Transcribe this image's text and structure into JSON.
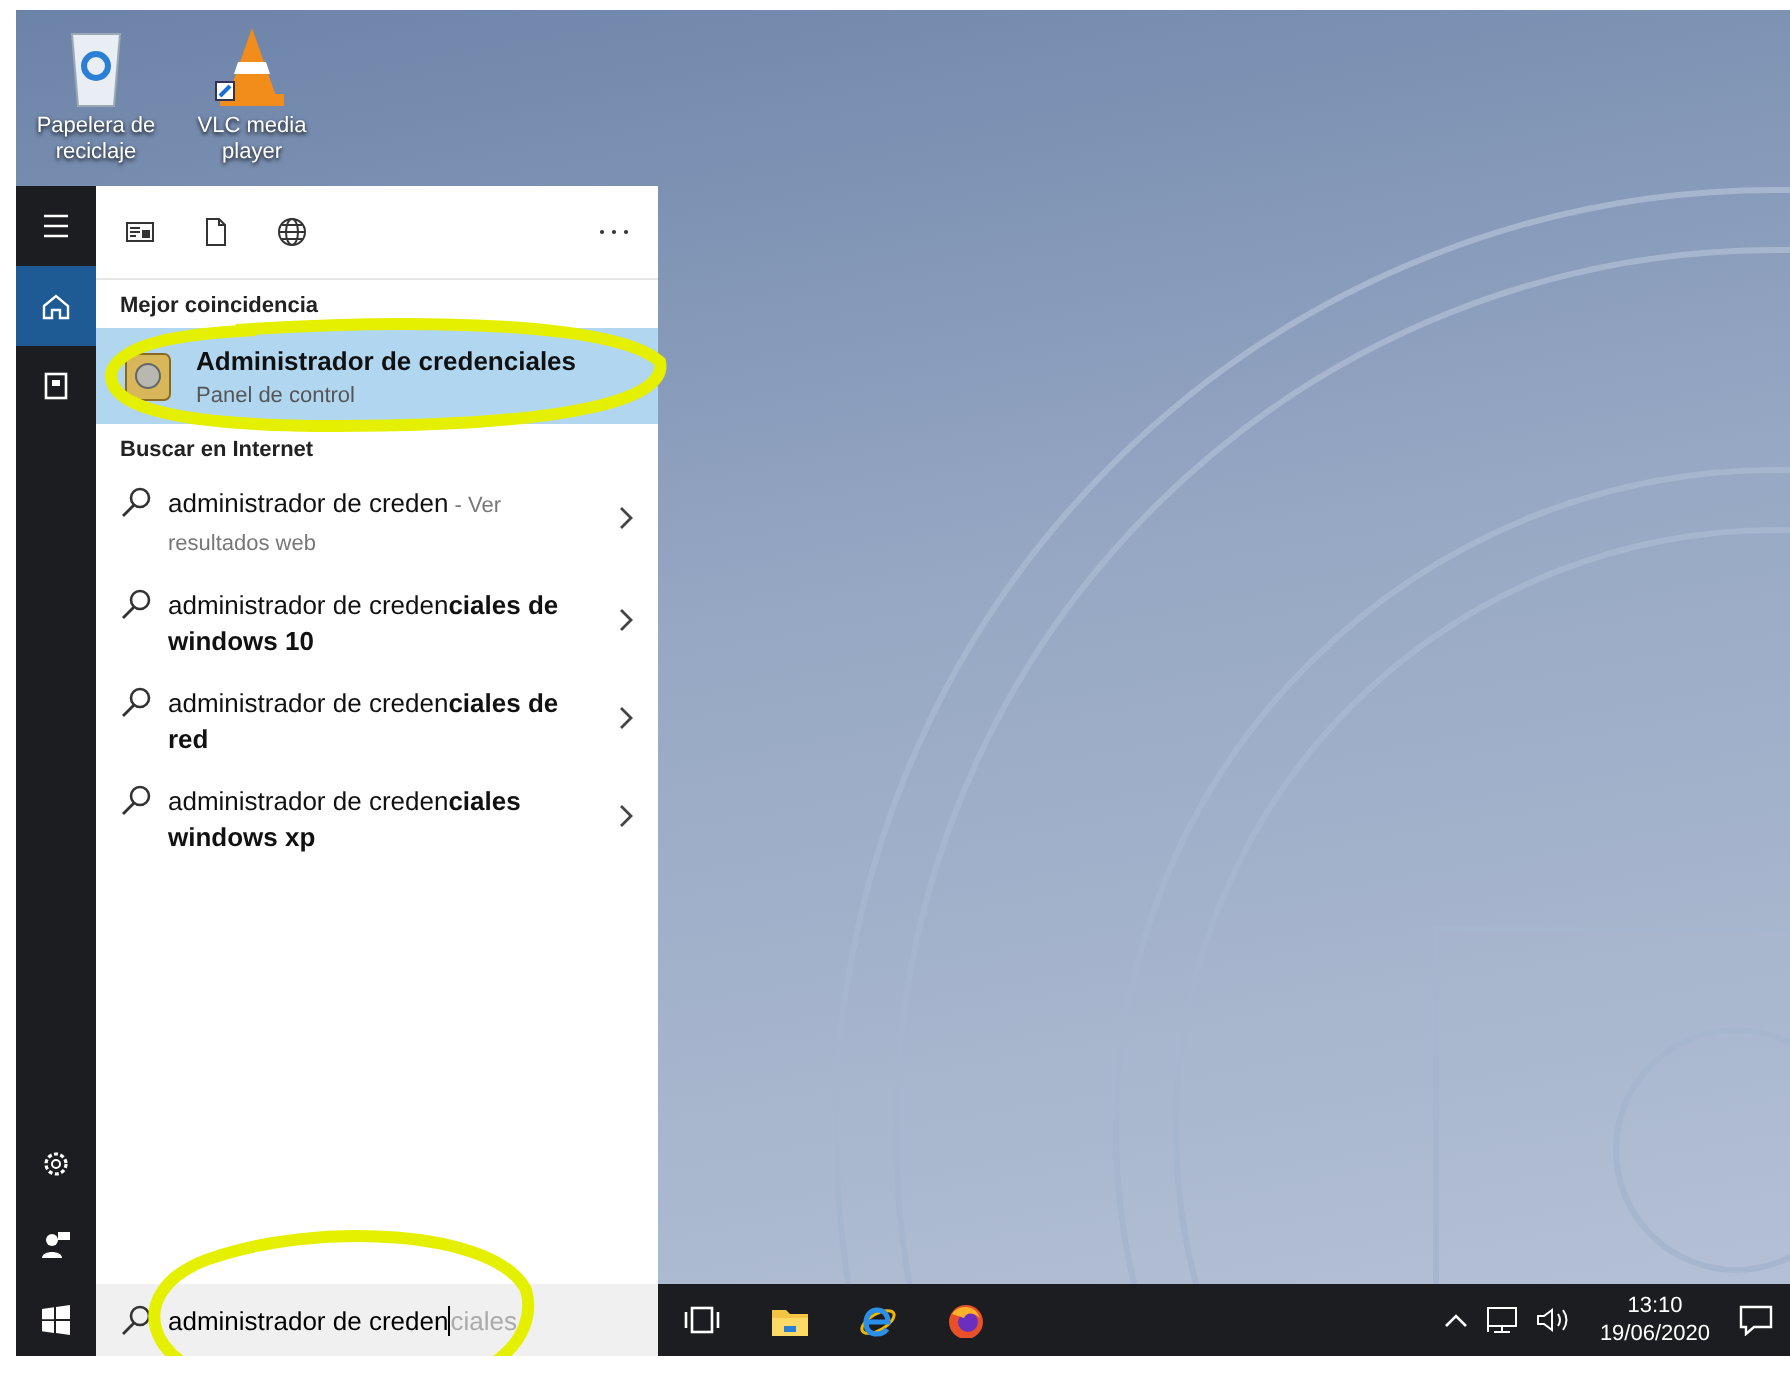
{
  "desktop_icons": [
    {
      "kind": "recycle",
      "label": "Papelera de reciclaje"
    },
    {
      "kind": "vlc",
      "label": "VLC media player"
    }
  ],
  "start_rail": {
    "top": [
      {
        "kind": "menu",
        "selected": false
      },
      {
        "kind": "home",
        "selected": true
      },
      {
        "kind": "collection",
        "selected": false
      }
    ],
    "bottom": [
      {
        "kind": "settings"
      },
      {
        "kind": "user"
      }
    ]
  },
  "filters": [
    {
      "kind": "apps"
    },
    {
      "kind": "documents"
    },
    {
      "kind": "web"
    }
  ],
  "best_match": {
    "heading": "Mejor coincidencia",
    "title": "Administrador de credenciales",
    "subtitle": "Panel de control",
    "selected": true
  },
  "web": {
    "heading": "Buscar en Internet",
    "results": [
      {
        "query": "administrador de creden",
        "note": " - Ver resultados web"
      },
      {
        "query": "administrador de creden**ciales de windows 10**"
      },
      {
        "query": "administrador de creden**ciales de red**"
      },
      {
        "query": "administrador de creden**ciales windows xp**"
      }
    ]
  },
  "search": {
    "value": "administrador de creden",
    "suggestion": "ciales"
  },
  "taskbar": {
    "apps": [
      {
        "kind": "task-view"
      },
      {
        "kind": "explorer"
      },
      {
        "kind": "ie"
      },
      {
        "kind": "firefox"
      }
    ],
    "clock": {
      "time": "13:10",
      "date": "19/06/2020"
    }
  }
}
